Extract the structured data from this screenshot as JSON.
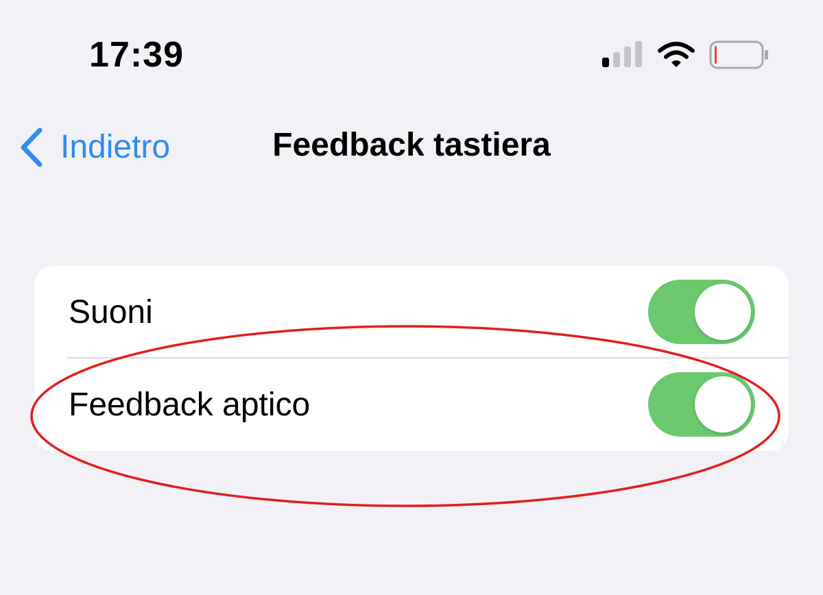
{
  "status_bar": {
    "time": "17:39",
    "icons": [
      "cellular-signal-icon",
      "wifi-icon",
      "battery-icon"
    ],
    "battery_level": 0.05,
    "battery_color": "#e5443a"
  },
  "nav": {
    "back_label": "Indietro",
    "back_icon": "chevron-left-icon",
    "title": "Feedback tastiera",
    "accent_color": "#2f8cf0"
  },
  "settings": {
    "rows": [
      {
        "label": "Suoni",
        "toggle_on": true
      },
      {
        "label": "Feedback aptico",
        "toggle_on": true
      }
    ],
    "toggle_on_color": "#6cc86e"
  },
  "annotation": {
    "shape": "ellipse",
    "color": "#e0201c",
    "highlights": "Feedback aptico"
  }
}
